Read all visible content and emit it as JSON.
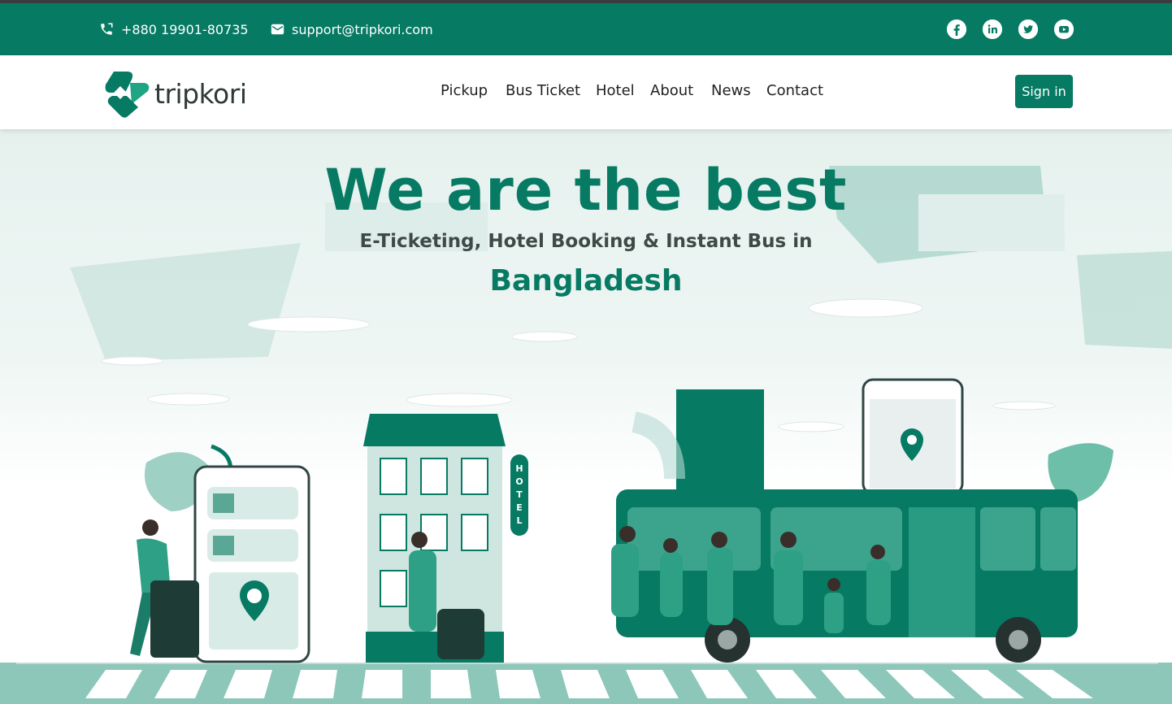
{
  "topbar": {
    "phone": "+880 19901-80735",
    "email": "support@tripkori.com",
    "social": [
      "facebook-icon",
      "linkedin-icon",
      "twitter-icon",
      "youtube-icon"
    ]
  },
  "brand": {
    "name": "tripkori",
    "color": "#067a63"
  },
  "nav": {
    "items": [
      "Pickup",
      "Bus Ticket",
      "Hotel",
      "About",
      "News",
      "Contact"
    ],
    "signin": "Sign in"
  },
  "hero": {
    "title": "We are the best",
    "subtitle": "E-Ticketing, Hotel Booking & Instant Bus in",
    "country": "Bangladesh",
    "hotel_sign": [
      "H",
      "O",
      "T",
      "E",
      "L"
    ]
  }
}
